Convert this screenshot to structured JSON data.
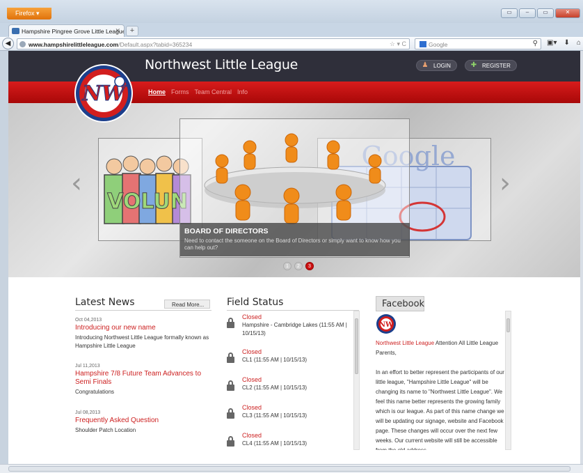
{
  "browser": {
    "app_button": "Firefox",
    "tab_title": "Hampshire Pingree Grove Little League ...",
    "url_host": "www.hampshirelittleleague.com",
    "url_path": "/Default.aspx?tabid=365234",
    "search_placeholder": "Google"
  },
  "site": {
    "title": "Northwest Little League",
    "login_label": "LOGIN",
    "register_label": "REGISTER",
    "menu": [
      "Home",
      "Forms",
      "Team Central",
      "Info"
    ],
    "active_menu": "Home"
  },
  "slider": {
    "caption_title": "BOARD OF DIRECTORS",
    "caption_text": "Need to contact the someone on the Board of Directors or simply want to know how you can help out?",
    "dots": [
      "1",
      "2",
      "3"
    ],
    "active_dot": 3,
    "left_card_text": "VOLUN",
    "right_card_text": "Google"
  },
  "news": {
    "heading": "Latest News",
    "read_more": "Read More...",
    "items": [
      {
        "date": "Oct 04,2013",
        "title": "Introducing our new name",
        "desc": "Introducing Northwest Little League formally known as Hampshire Little League"
      },
      {
        "date": "Jul 11,2013",
        "title": "Hampshire 7/8 Future Team Advances to Semi Finals",
        "desc": "Congratulations"
      },
      {
        "date": "Jul 08,2013",
        "title": "Frequently Asked Question",
        "desc": "Shoulder Patch Location"
      }
    ]
  },
  "fields": {
    "heading": "Field Status",
    "items": [
      {
        "status": "Closed",
        "name": "Hampshire - Cambridge Lakes (11:55 AM | 10/15/13)"
      },
      {
        "status": "Closed",
        "name": "CL1 (11:55 AM | 10/15/13)"
      },
      {
        "status": "Closed",
        "name": "CL2 (11:55 AM | 10/15/13)"
      },
      {
        "status": "Closed",
        "name": "CL3 (11:55 AM | 10/15/13)"
      },
      {
        "status": "Closed",
        "name": "CL4 (11:55 AM | 10/15/13)"
      }
    ]
  },
  "facebook": {
    "heading": "Facebook",
    "page_name": "Northwest Little League",
    "post_intro": " Attention All Little League Parents,",
    "post_body": "In an effort to better represent the participants of our little league, \"Hampshire Little League\" will be changing its name to \"Northwest Little League\". We feel this name better represents the growing family which is our league. As part of this name change we will be updating our signage, website and Facebook page. These changes will occur over the next few weeks. Our current website will still be accessible from the old address"
  },
  "colors": {
    "accent_red": "#cc1f1f",
    "header_dark": "#2f2f3a",
    "firefox_orange": "#e8820f"
  }
}
